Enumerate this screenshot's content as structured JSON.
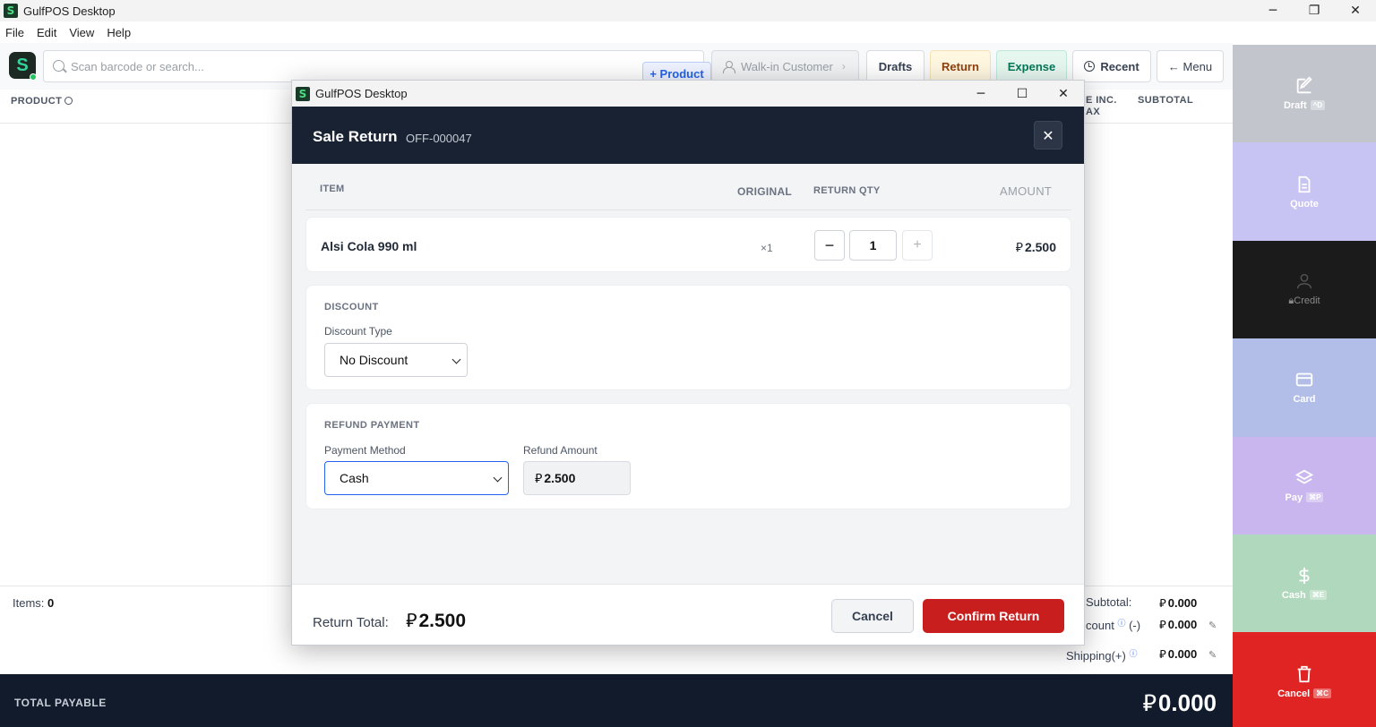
{
  "window": {
    "title": "GulfPOS Desktop",
    "app_icon": "S",
    "controls": {
      "minimize": "─",
      "maximize": "❐",
      "close": "✕"
    }
  },
  "menu": [
    "File",
    "Edit",
    "View",
    "Help"
  ],
  "toolbar": {
    "logo": "S",
    "search_placeholder": "Scan barcode or search...",
    "add_product": "+ Product",
    "customer": "Walk-in Customer",
    "customer_chevron": "›",
    "drafts": "Drafts",
    "return": "Return",
    "expense": "Expense",
    "recent": "Recent",
    "menu": "← Menu"
  },
  "table": {
    "col_product": "PRODUCT",
    "col_price_inc_tax_1": "E INC.",
    "col_price_inc_tax_2": "AX",
    "col_subtotal": "SUBTOTAL"
  },
  "summary": {
    "items_label": "Items:",
    "items_count": "0",
    "subtotal_label": "Subtotal:",
    "subtotal": "0.000",
    "discount_label": "count",
    "discount_sign": "(-)",
    "discount": "0.000",
    "shipping_label": "Shipping(+)",
    "shipping": "0.000",
    "total_label": "TOTAL PAYABLE",
    "total": "0.000",
    "currency_symbol": "⃁"
  },
  "actions": [
    {
      "label": "Draft",
      "shortcut": "^D",
      "icon": "edit-icon"
    },
    {
      "label": "Quote",
      "shortcut": "",
      "icon": "document-icon"
    },
    {
      "label": "Credit",
      "shortcut": "",
      "icon": "person-icon"
    },
    {
      "label": "Card",
      "shortcut": "",
      "icon": "card-icon"
    },
    {
      "label": "Pay",
      "shortcut": "⌘P",
      "icon": "layers-icon"
    },
    {
      "label": "Cash",
      "shortcut": "⌘E",
      "icon": "dollar-icon"
    },
    {
      "label": "Cancel",
      "shortcut": "⌘C",
      "icon": "trash-icon"
    }
  ],
  "dialog": {
    "window_title": "GulfPOS Desktop",
    "title": "Sale Return",
    "reference": "OFF-000047",
    "close": "✕",
    "columns": {
      "item": "ITEM",
      "original": "ORIGINAL",
      "return_qty": "RETURN QTY",
      "amount": "AMOUNT"
    },
    "items": [
      {
        "name": "Alsi Cola 990 ml",
        "original": "×1",
        "return_qty": "1",
        "amount": "2.500"
      }
    ],
    "qty_minus": "−",
    "qty_plus": "+",
    "discount": {
      "section": "DISCOUNT",
      "type_label": "Discount Type",
      "type_value": "No Discount"
    },
    "refund": {
      "section": "REFUND PAYMENT",
      "method_label": "Payment Method",
      "method_value": "Cash",
      "amount_label": "Refund Amount",
      "amount_value": "2.500"
    },
    "footer": {
      "total_label": "Return Total:",
      "total_value": "2.500",
      "cancel": "Cancel",
      "confirm": "Confirm Return"
    }
  },
  "colors": {
    "header_dark": "#182232",
    "confirm_red": "#c81e1e",
    "cancel_red": "#e02424",
    "accent_blue": "#2563eb"
  }
}
